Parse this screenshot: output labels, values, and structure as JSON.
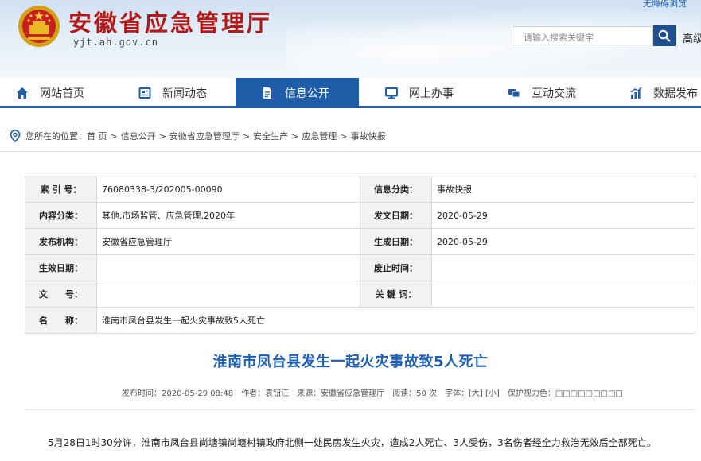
{
  "header": {
    "site_title": "安徽省应急管理厅",
    "site_url": "yjt.ah.gov.cn",
    "accessibility_link": "无障碍浏览",
    "search_placeholder": "请输入搜索关键字",
    "advanced_search": "高级"
  },
  "nav": {
    "items": [
      {
        "label": "网站首页",
        "icon": "home-icon"
      },
      {
        "label": "新闻动态",
        "icon": "news-icon"
      },
      {
        "label": "信息公开",
        "icon": "document-icon",
        "active": true
      },
      {
        "label": "网上办事",
        "icon": "monitor-icon"
      },
      {
        "label": "互动交流",
        "icon": "chat-icon"
      },
      {
        "label": "数据发布",
        "icon": "chart-icon"
      }
    ]
  },
  "breadcrumb": {
    "prefix": "您所在的位置：",
    "path": [
      "首 页",
      "信息公开",
      "安徽省应急管理厅",
      "安全生产",
      "应急管理",
      "事故快报"
    ],
    "separator": ">"
  },
  "info_table": {
    "rows": [
      [
        {
          "label": "索 引 号：",
          "value": "76080338-3/202005-00090"
        },
        {
          "label": "信息分类：",
          "value": "事故快报"
        }
      ],
      [
        {
          "label": "内容分类：",
          "value": "其他,市场监管、应急管理,2020年"
        },
        {
          "label": "发文日期：",
          "value": "2020-05-29"
        }
      ],
      [
        {
          "label": "发布机构：",
          "value": "安徽省应急管理厅"
        },
        {
          "label": "生成日期：",
          "value": "2020-05-29"
        }
      ],
      [
        {
          "label": "生效日期：",
          "value": ""
        },
        {
          "label": "废止时间：",
          "value": ""
        }
      ],
      [
        {
          "label": "文　　号：",
          "value": ""
        },
        {
          "label": "关 键 词：",
          "value": ""
        }
      ]
    ],
    "name_row": {
      "label": "名　　称：",
      "value": "淮南市凤台县发生一起火灾事故致5人死亡"
    }
  },
  "article": {
    "title": "淮南市凤台县发生一起火灾事故致5人死亡",
    "meta": {
      "publish_time": "发布时间：2020-05-29 08:48",
      "author": "作者：袁钮江",
      "source": "来源：安徽省应急管理厅",
      "reads": "阅读：50 次",
      "font_size": "字体：[大] [小]",
      "eye_protect": "保护视力色：",
      "color_swatches": "□□□□□□□□□"
    },
    "body": "5月28日1时30分许，淮南市凤台县尚塘镇尚塘村镇政府北侧一处民房发生火灾，造成2人死亡、3人受伤，3名伤者经全力救治无效后全部死亡。"
  },
  "colors": {
    "brand_red": "#b21a1a",
    "nav_blue": "#1f5da8",
    "title_blue": "#1d5fb2"
  }
}
